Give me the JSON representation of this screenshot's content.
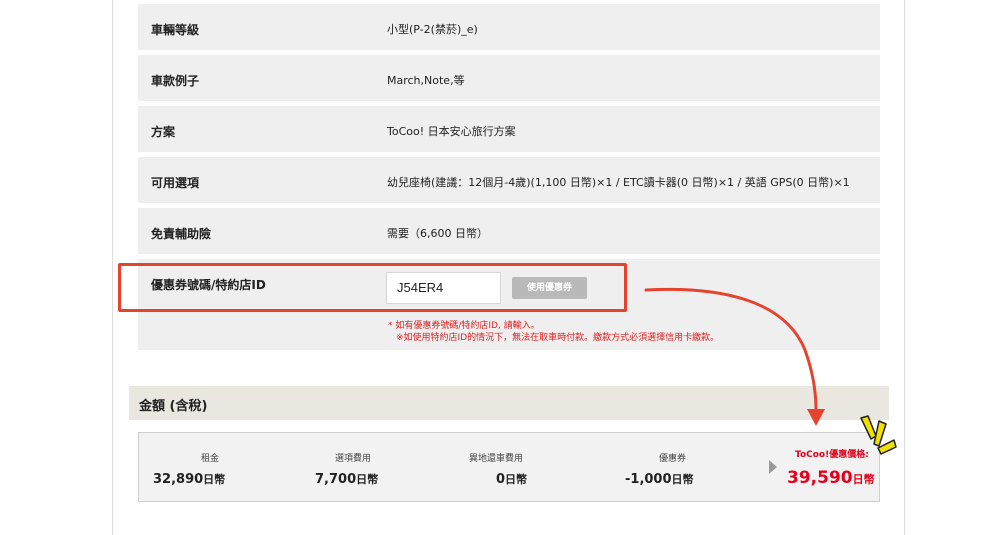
{
  "details": {
    "rows": [
      {
        "label": "車輛等級",
        "value": "小型(P-2(禁菸)_e)"
      },
      {
        "label": "車款例子",
        "value": "March,Note,等"
      },
      {
        "label": "方案",
        "value": "ToCoo! 日本安心旅行方案"
      },
      {
        "label": "可用選項",
        "value": "幼兒座椅(建議：12個月-4歲)(1,100 日幣)×1 / ETC讀卡器(0 日幣)×1 / 英語 GPS(0 日幣)×1"
      },
      {
        "label": "免責輔助險",
        "value": "需要（6,600 日幣）"
      }
    ]
  },
  "coupon": {
    "label": "優惠券號碼/特約店ID",
    "input_value": "J54ER4",
    "button_label": "使用優惠券",
    "note_1": "* 如有優惠券號碼/特約店ID, 請輸入。",
    "note_2": "※如使用特約店ID的情況下，無法在取車時付款。繳款方式必須選擇信用卡繳款。"
  },
  "total": {
    "header": "金額 (含稅)",
    "columns": [
      {
        "label": "租金",
        "value": "32,890",
        "unit": "日幣"
      },
      {
        "label": "選項費用",
        "value": "7,700",
        "unit": "日幣"
      },
      {
        "label": "異地還車費用",
        "value": "0",
        "unit": "日幣"
      },
      {
        "label": "優惠券",
        "value": "-1,000",
        "unit": "日幣"
      }
    ],
    "final_label": "ToCoo!優惠價格:",
    "final_value": "39,590",
    "final_unit": "日幣"
  },
  "colors": {
    "accent_red": "#e3001b",
    "annotation_red": "#e4442f",
    "sparkle_yellow": "#f2e000"
  },
  "icons": [
    "arrow-right-triangle-icon",
    "annotation-arrow",
    "sparkle-icon"
  ]
}
